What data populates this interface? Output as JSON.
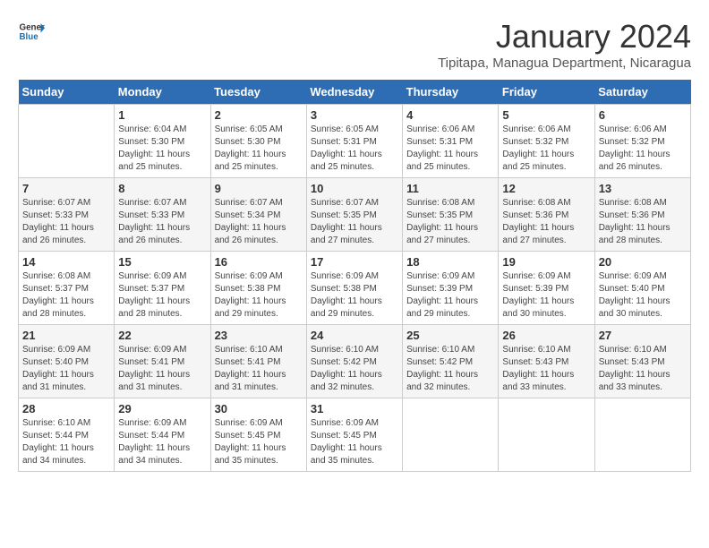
{
  "logo": {
    "general": "General",
    "blue": "Blue"
  },
  "header": {
    "month_year": "January 2024",
    "location": "Tipitapa, Managua Department, Nicaragua"
  },
  "days_of_week": [
    "Sunday",
    "Monday",
    "Tuesday",
    "Wednesday",
    "Thursday",
    "Friday",
    "Saturday"
  ],
  "weeks": [
    [
      {
        "day": "",
        "info": ""
      },
      {
        "day": "1",
        "info": "Sunrise: 6:04 AM\nSunset: 5:30 PM\nDaylight: 11 hours\nand 25 minutes."
      },
      {
        "day": "2",
        "info": "Sunrise: 6:05 AM\nSunset: 5:30 PM\nDaylight: 11 hours\nand 25 minutes."
      },
      {
        "day": "3",
        "info": "Sunrise: 6:05 AM\nSunset: 5:31 PM\nDaylight: 11 hours\nand 25 minutes."
      },
      {
        "day": "4",
        "info": "Sunrise: 6:06 AM\nSunset: 5:31 PM\nDaylight: 11 hours\nand 25 minutes."
      },
      {
        "day": "5",
        "info": "Sunrise: 6:06 AM\nSunset: 5:32 PM\nDaylight: 11 hours\nand 25 minutes."
      },
      {
        "day": "6",
        "info": "Sunrise: 6:06 AM\nSunset: 5:32 PM\nDaylight: 11 hours\nand 26 minutes."
      }
    ],
    [
      {
        "day": "7",
        "info": "Sunrise: 6:07 AM\nSunset: 5:33 PM\nDaylight: 11 hours\nand 26 minutes."
      },
      {
        "day": "8",
        "info": "Sunrise: 6:07 AM\nSunset: 5:33 PM\nDaylight: 11 hours\nand 26 minutes."
      },
      {
        "day": "9",
        "info": "Sunrise: 6:07 AM\nSunset: 5:34 PM\nDaylight: 11 hours\nand 26 minutes."
      },
      {
        "day": "10",
        "info": "Sunrise: 6:07 AM\nSunset: 5:35 PM\nDaylight: 11 hours\nand 27 minutes."
      },
      {
        "day": "11",
        "info": "Sunrise: 6:08 AM\nSunset: 5:35 PM\nDaylight: 11 hours\nand 27 minutes."
      },
      {
        "day": "12",
        "info": "Sunrise: 6:08 AM\nSunset: 5:36 PM\nDaylight: 11 hours\nand 27 minutes."
      },
      {
        "day": "13",
        "info": "Sunrise: 6:08 AM\nSunset: 5:36 PM\nDaylight: 11 hours\nand 28 minutes."
      }
    ],
    [
      {
        "day": "14",
        "info": "Sunrise: 6:08 AM\nSunset: 5:37 PM\nDaylight: 11 hours\nand 28 minutes."
      },
      {
        "day": "15",
        "info": "Sunrise: 6:09 AM\nSunset: 5:37 PM\nDaylight: 11 hours\nand 28 minutes."
      },
      {
        "day": "16",
        "info": "Sunrise: 6:09 AM\nSunset: 5:38 PM\nDaylight: 11 hours\nand 29 minutes."
      },
      {
        "day": "17",
        "info": "Sunrise: 6:09 AM\nSunset: 5:38 PM\nDaylight: 11 hours\nand 29 minutes."
      },
      {
        "day": "18",
        "info": "Sunrise: 6:09 AM\nSunset: 5:39 PM\nDaylight: 11 hours\nand 29 minutes."
      },
      {
        "day": "19",
        "info": "Sunrise: 6:09 AM\nSunset: 5:39 PM\nDaylight: 11 hours\nand 30 minutes."
      },
      {
        "day": "20",
        "info": "Sunrise: 6:09 AM\nSunset: 5:40 PM\nDaylight: 11 hours\nand 30 minutes."
      }
    ],
    [
      {
        "day": "21",
        "info": "Sunrise: 6:09 AM\nSunset: 5:40 PM\nDaylight: 11 hours\nand 31 minutes."
      },
      {
        "day": "22",
        "info": "Sunrise: 6:09 AM\nSunset: 5:41 PM\nDaylight: 11 hours\nand 31 minutes."
      },
      {
        "day": "23",
        "info": "Sunrise: 6:10 AM\nSunset: 5:41 PM\nDaylight: 11 hours\nand 31 minutes."
      },
      {
        "day": "24",
        "info": "Sunrise: 6:10 AM\nSunset: 5:42 PM\nDaylight: 11 hours\nand 32 minutes."
      },
      {
        "day": "25",
        "info": "Sunrise: 6:10 AM\nSunset: 5:42 PM\nDaylight: 11 hours\nand 32 minutes."
      },
      {
        "day": "26",
        "info": "Sunrise: 6:10 AM\nSunset: 5:43 PM\nDaylight: 11 hours\nand 33 minutes."
      },
      {
        "day": "27",
        "info": "Sunrise: 6:10 AM\nSunset: 5:43 PM\nDaylight: 11 hours\nand 33 minutes."
      }
    ],
    [
      {
        "day": "28",
        "info": "Sunrise: 6:10 AM\nSunset: 5:44 PM\nDaylight: 11 hours\nand 34 minutes."
      },
      {
        "day": "29",
        "info": "Sunrise: 6:09 AM\nSunset: 5:44 PM\nDaylight: 11 hours\nand 34 minutes."
      },
      {
        "day": "30",
        "info": "Sunrise: 6:09 AM\nSunset: 5:45 PM\nDaylight: 11 hours\nand 35 minutes."
      },
      {
        "day": "31",
        "info": "Sunrise: 6:09 AM\nSunset: 5:45 PM\nDaylight: 11 hours\nand 35 minutes."
      },
      {
        "day": "",
        "info": ""
      },
      {
        "day": "",
        "info": ""
      },
      {
        "day": "",
        "info": ""
      }
    ]
  ]
}
